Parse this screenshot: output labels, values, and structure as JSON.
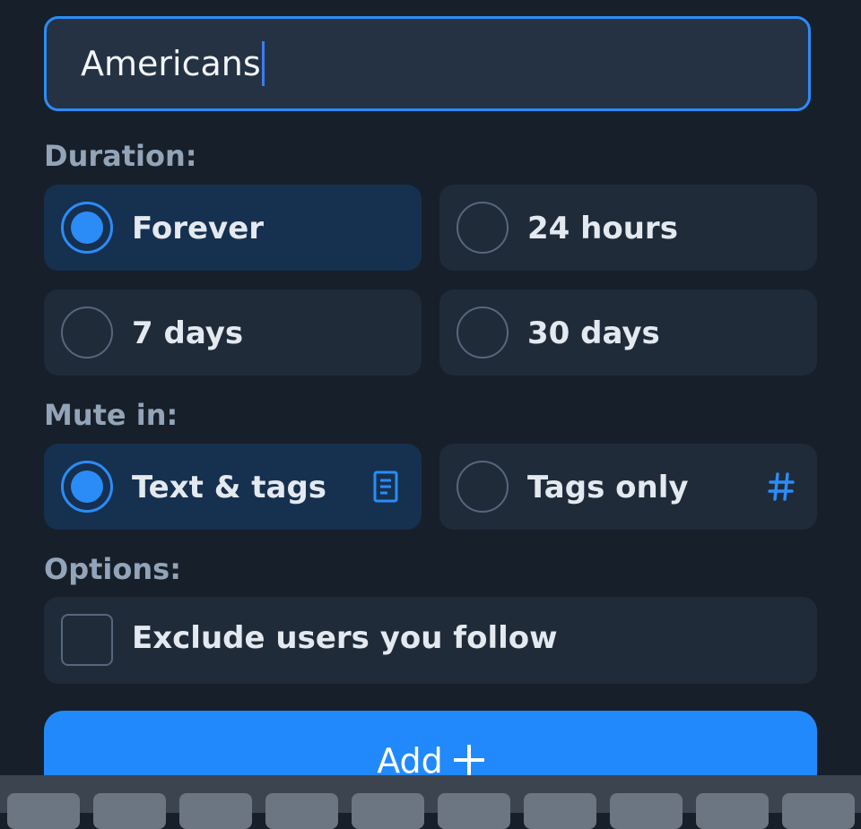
{
  "input": {
    "value": "Americans"
  },
  "duration": {
    "label": "Duration:",
    "options": [
      {
        "label": "Forever",
        "selected": true
      },
      {
        "label": "24 hours",
        "selected": false
      },
      {
        "label": "7 days",
        "selected": false
      },
      {
        "label": "30 days",
        "selected": false
      }
    ]
  },
  "mute_in": {
    "label": "Mute in:",
    "options": [
      {
        "label": "Text & tags",
        "selected": true,
        "icon": "document-icon"
      },
      {
        "label": "Tags only",
        "selected": false,
        "icon": "hashtag-icon"
      }
    ]
  },
  "options": {
    "label": "Options:",
    "exclude_following": {
      "label": "Exclude users you follow",
      "checked": false
    }
  },
  "add_button": {
    "label": "Add"
  },
  "colors": {
    "background": "#171f2a",
    "accent": "#2b8cf7",
    "card": "#1f2b39",
    "card_selected": "#16304f",
    "muted_text": "#93a4b8"
  }
}
